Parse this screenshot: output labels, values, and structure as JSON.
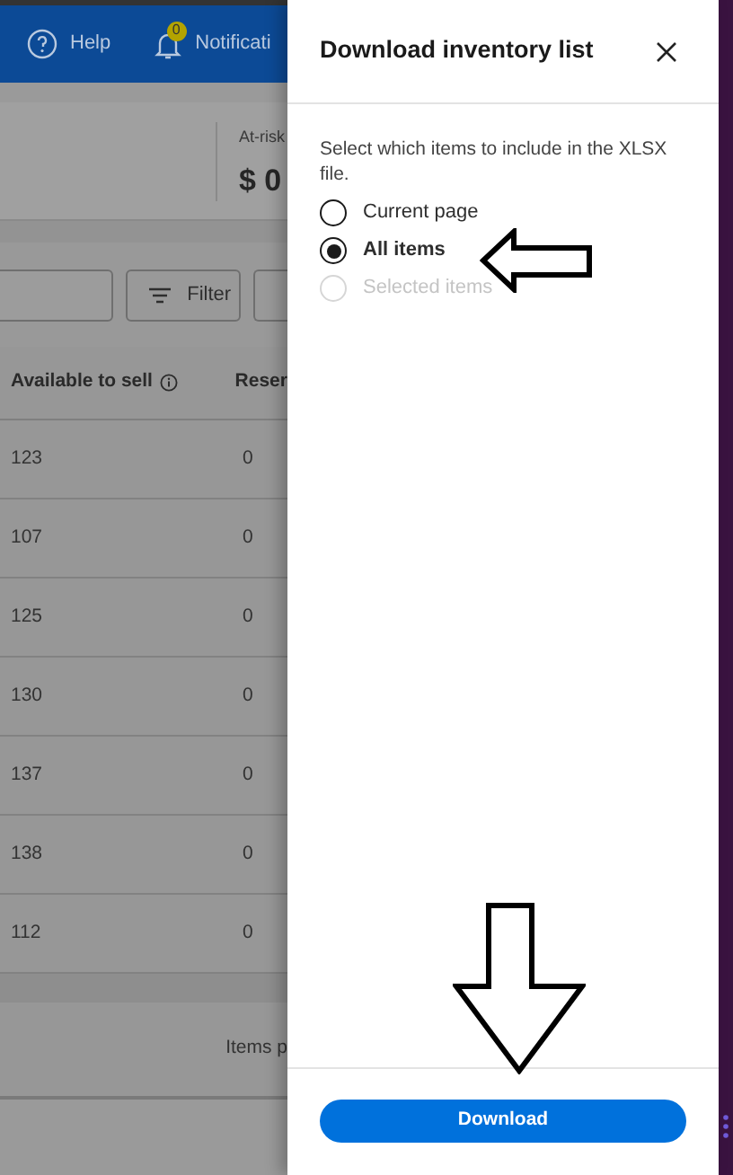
{
  "top_bar": {
    "help": "Help",
    "notifications": {
      "label": "Notificati",
      "badge": "0"
    }
  },
  "summary": {
    "label": "At-risk",
    "value": "$ 0"
  },
  "toolbar": {
    "filter": "Filter"
  },
  "table": {
    "columns": [
      "Available to sell",
      "Reser"
    ],
    "rows": [
      [
        "123",
        "0"
      ],
      [
        "107",
        "0"
      ],
      [
        "125",
        "0"
      ],
      [
        "130",
        "0"
      ],
      [
        "137",
        "0"
      ],
      [
        "138",
        "0"
      ],
      [
        "112",
        "0"
      ]
    ]
  },
  "footer": {
    "items_per_page": "Items p"
  },
  "dialog": {
    "title": "Download inventory list",
    "description": "Select which items to include in the XLSX file.",
    "options": [
      {
        "label": "Current page",
        "selected": false,
        "disabled": false
      },
      {
        "label": "All items",
        "selected": true,
        "disabled": false
      },
      {
        "label": "Selected items",
        "selected": false,
        "disabled": true
      }
    ],
    "button": "Download"
  }
}
